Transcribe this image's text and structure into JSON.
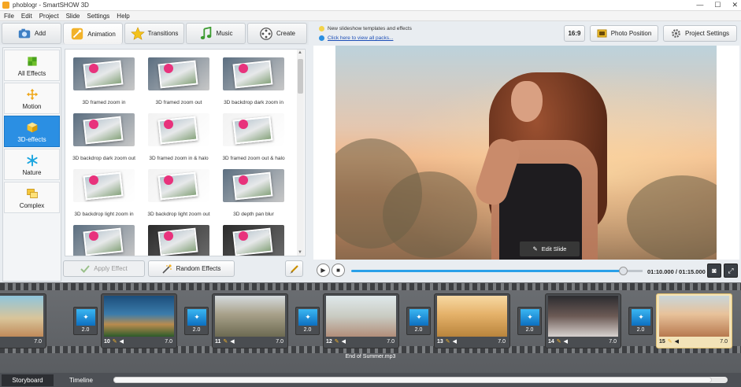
{
  "window": {
    "title": "phoblogr - SmartSHOW 3D",
    "controls": [
      "—",
      "☐",
      "✕"
    ]
  },
  "menu": [
    "File",
    "Edit",
    "Project",
    "Slide",
    "Settings",
    "Help"
  ],
  "tabs": [
    {
      "label": "Add",
      "icon": "camera-icon"
    },
    {
      "label": "Animation",
      "icon": "magic-wand-icon",
      "active": true
    },
    {
      "label": "Transitions",
      "icon": "star-icon"
    },
    {
      "label": "Music",
      "icon": "music-note-icon"
    },
    {
      "label": "Create",
      "icon": "film-reel-icon"
    }
  ],
  "categories": [
    {
      "label": "All Effects",
      "icon": "puzzle-icon"
    },
    {
      "label": "Motion",
      "icon": "move-arrows-icon"
    },
    {
      "label": "3D-effects",
      "icon": "cube-icon",
      "active": true
    },
    {
      "label": "Nature",
      "icon": "snowflake-icon"
    },
    {
      "label": "Complex",
      "icon": "layers-icon"
    }
  ],
  "effects": [
    {
      "label": "3D framed zoom in",
      "style": "grey"
    },
    {
      "label": "3D framed zoom out",
      "style": "grey"
    },
    {
      "label": "3D backdrop dark zoom in",
      "style": "grey"
    },
    {
      "label": "3D backdrop dark zoom out",
      "style": "grey"
    },
    {
      "label": "3D framed zoom in & halo",
      "style": "light"
    },
    {
      "label": "3D framed zoom out & halo",
      "style": "light"
    },
    {
      "label": "3D backdrop light zoom in",
      "style": "light"
    },
    {
      "label": "3D backdrop light zoom out",
      "style": "light"
    },
    {
      "label": "3D depth pan blur",
      "style": "grey"
    },
    {
      "label": "",
      "style": "grey"
    },
    {
      "label": "",
      "style": "dark"
    },
    {
      "label": "",
      "style": "dark"
    }
  ],
  "effect_buttons": {
    "apply": "Apply Effect",
    "random": "Random Effects"
  },
  "promo": {
    "line1": "New slideshow templates and effects",
    "line2": "Click here to view all packs..."
  },
  "toolbar": {
    "aspect": "16:9",
    "photo_position": "Photo Position",
    "project_settings": "Project Settings"
  },
  "preview": {
    "edit_slide": "Edit Slide"
  },
  "playback": {
    "timecode": "01:10.000 / 01:15.000",
    "progress": 0.933
  },
  "slides": [
    {
      "num": "",
      "duration": "7.0",
      "scene": "beach"
    },
    {
      "num": "10",
      "duration": "7.0",
      "scene": "castle"
    },
    {
      "num": "11",
      "duration": "7.0",
      "scene": "street"
    },
    {
      "num": "12",
      "duration": "7.0",
      "scene": "park"
    },
    {
      "num": "13",
      "duration": "7.0",
      "scene": "field"
    },
    {
      "num": "14",
      "duration": "7.0",
      "scene": "couple"
    },
    {
      "num": "15",
      "duration": "7.0",
      "scene": "sunset",
      "selected": true
    }
  ],
  "transitions": [
    "2.0",
    "2.0",
    "2.0",
    "2.0",
    "2.0",
    "2.0"
  ],
  "audio": {
    "track": "End of Summer.mp3"
  },
  "bottom_tabs": [
    {
      "label": "Storyboard",
      "active": true
    },
    {
      "label": "Timeline"
    }
  ],
  "colors": {
    "accent": "#2b8fe3",
    "track": "#2aa0e8",
    "filmstrip": "#5e6165"
  }
}
